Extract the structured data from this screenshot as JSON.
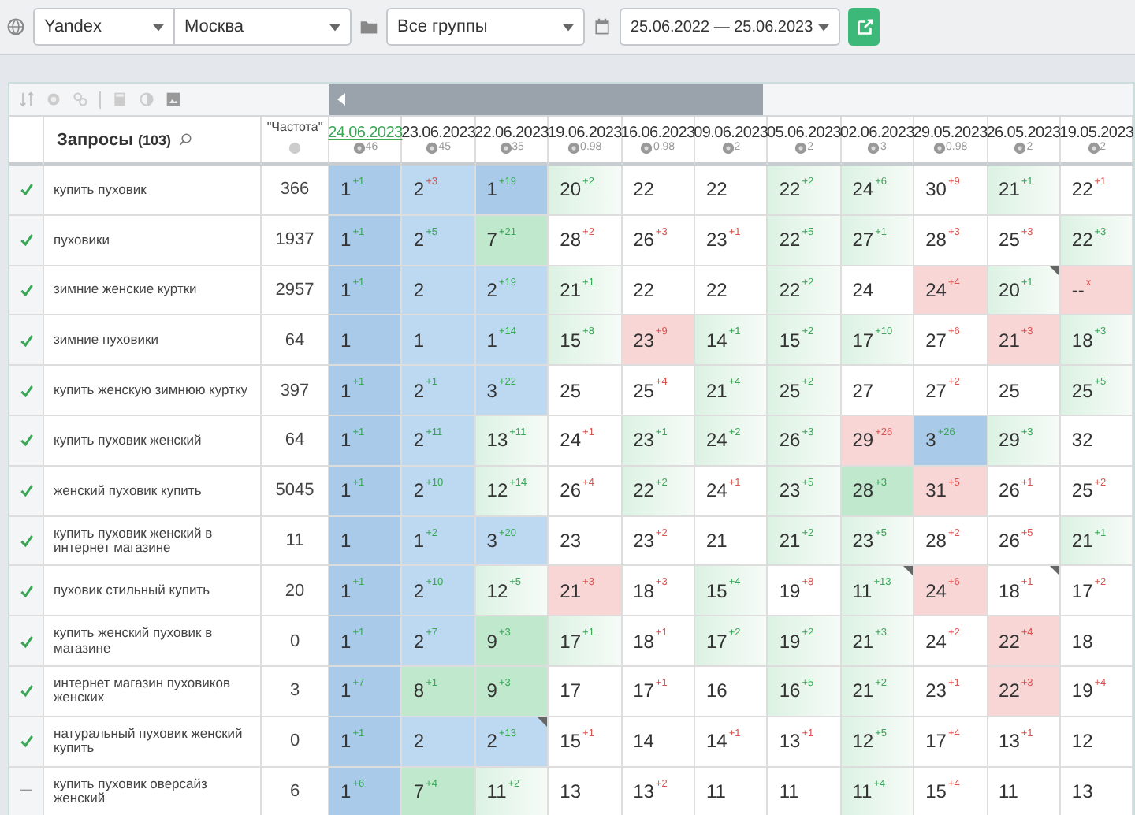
{
  "filters": {
    "engine": "Yandex",
    "region": "Москва",
    "group": "Все группы",
    "period": "25.06.2022 — 25.06.2023"
  },
  "table": {
    "query_header": "Запросы",
    "query_count": "(103)",
    "frequency_header": "\"Частота\"",
    "dates": [
      {
        "label": "24.06.2023",
        "value": "46",
        "selected": true
      },
      {
        "label": "23.06.2023",
        "value": "45",
        "selected": false
      },
      {
        "label": "22.06.2023",
        "value": "35",
        "selected": false
      },
      {
        "label": "19.06.2023",
        "value": "0.98",
        "selected": false
      },
      {
        "label": "16.06.2023",
        "value": "0.98",
        "selected": false
      },
      {
        "label": "09.06.2023",
        "value": "2",
        "selected": false
      },
      {
        "label": "05.06.2023",
        "value": "2",
        "selected": false
      },
      {
        "label": "02.06.2023",
        "value": "3",
        "selected": false
      },
      {
        "label": "29.05.2023",
        "value": "0.98",
        "selected": false
      },
      {
        "label": "26.05.2023",
        "value": "2",
        "selected": false
      },
      {
        "label": "19.05.2023",
        "value": "2",
        "selected": false
      }
    ],
    "rows": [
      {
        "query": "купить пуховик",
        "frequency": "366",
        "checked": true,
        "cells": [
          {
            "value": "1",
            "change": "+1",
            "improved": true,
            "kind": "blue"
          },
          {
            "value": "2",
            "change": "+3",
            "improved": false,
            "kind": "sky"
          },
          {
            "value": "1",
            "change": "+19",
            "improved": true,
            "kind": "blue"
          },
          {
            "value": "20",
            "change": "+2",
            "improved": true,
            "kind": "mint"
          },
          {
            "value": "22",
            "kind": "plain"
          },
          {
            "value": "22",
            "kind": "plain"
          },
          {
            "value": "22",
            "change": "+2",
            "improved": true,
            "kind": "mint"
          },
          {
            "value": "24",
            "change": "+6",
            "improved": true,
            "kind": "mint"
          },
          {
            "value": "30",
            "change": "+9",
            "improved": false,
            "kind": "plain"
          },
          {
            "value": "21",
            "change": "+1",
            "improved": true,
            "kind": "mint"
          },
          {
            "value": "22",
            "change": "+1",
            "improved": false,
            "kind": "plain"
          }
        ]
      },
      {
        "query": "пуховики",
        "frequency": "1937",
        "checked": true,
        "cells": [
          {
            "value": "1",
            "change": "+1",
            "improved": true,
            "kind": "blue"
          },
          {
            "value": "2",
            "change": "+5",
            "improved": true,
            "kind": "sky"
          },
          {
            "value": "7",
            "change": "+21",
            "improved": true,
            "kind": "green"
          },
          {
            "value": "28",
            "change": "+2",
            "improved": false,
            "kind": "plain"
          },
          {
            "value": "26",
            "change": "+3",
            "improved": false,
            "kind": "plain"
          },
          {
            "value": "23",
            "change": "+1",
            "improved": false,
            "kind": "plain"
          },
          {
            "value": "22",
            "change": "+5",
            "improved": true,
            "kind": "mint"
          },
          {
            "value": "27",
            "change": "+1",
            "improved": true,
            "kind": "mint"
          },
          {
            "value": "28",
            "change": "+3",
            "improved": false,
            "kind": "plain"
          },
          {
            "value": "25",
            "change": "+3",
            "improved": false,
            "kind": "plain"
          },
          {
            "value": "22",
            "change": "+3",
            "improved": true,
            "kind": "mint"
          }
        ]
      },
      {
        "query": "зимние женские куртки",
        "frequency": "2957",
        "checked": true,
        "cells": [
          {
            "value": "1",
            "change": "+1",
            "improved": true,
            "kind": "blue"
          },
          {
            "value": "2",
            "kind": "sky"
          },
          {
            "value": "2",
            "change": "+19",
            "improved": true,
            "kind": "sky"
          },
          {
            "value": "21",
            "change": "+1",
            "improved": true,
            "kind": "mint"
          },
          {
            "value": "22",
            "kind": "plain"
          },
          {
            "value": "22",
            "kind": "plain"
          },
          {
            "value": "22",
            "change": "+2",
            "improved": true,
            "kind": "mint"
          },
          {
            "value": "24",
            "kind": "plain"
          },
          {
            "value": "24",
            "change": "+4",
            "improved": false,
            "kind": "red"
          },
          {
            "value": "20",
            "change": "+1",
            "improved": true,
            "kind": "mint",
            "flagged": true
          },
          {
            "value": "--",
            "change": "x",
            "improved": false,
            "kind": "red"
          }
        ]
      },
      {
        "query": "зимние пуховики",
        "frequency": "64",
        "checked": true,
        "cells": [
          {
            "value": "1",
            "kind": "blue"
          },
          {
            "value": "1",
            "kind": "sky"
          },
          {
            "value": "1",
            "change": "+14",
            "improved": true,
            "kind": "sky"
          },
          {
            "value": "15",
            "change": "+8",
            "improved": true,
            "kind": "mint"
          },
          {
            "value": "23",
            "change": "+9",
            "improved": false,
            "kind": "red"
          },
          {
            "value": "14",
            "change": "+1",
            "improved": true,
            "kind": "mint"
          },
          {
            "value": "15",
            "change": "+2",
            "improved": true,
            "kind": "mint"
          },
          {
            "value": "17",
            "change": "+10",
            "improved": true,
            "kind": "mint"
          },
          {
            "value": "27",
            "change": "+6",
            "improved": false,
            "kind": "plain"
          },
          {
            "value": "21",
            "change": "+3",
            "improved": false,
            "kind": "red"
          },
          {
            "value": "18",
            "change": "+3",
            "improved": true,
            "kind": "mint"
          }
        ]
      },
      {
        "query": "купить женскую зимнюю куртку",
        "frequency": "397",
        "checked": true,
        "cells": [
          {
            "value": "1",
            "change": "+1",
            "improved": true,
            "kind": "blue"
          },
          {
            "value": "2",
            "change": "+1",
            "improved": true,
            "kind": "sky"
          },
          {
            "value": "3",
            "change": "+22",
            "improved": true,
            "kind": "sky"
          },
          {
            "value": "25",
            "kind": "plain"
          },
          {
            "value": "25",
            "change": "+4",
            "improved": false,
            "kind": "plain"
          },
          {
            "value": "21",
            "change": "+4",
            "improved": true,
            "kind": "mint"
          },
          {
            "value": "25",
            "change": "+2",
            "improved": true,
            "kind": "mint"
          },
          {
            "value": "27",
            "kind": "plain"
          },
          {
            "value": "27",
            "change": "+2",
            "improved": false,
            "kind": "plain"
          },
          {
            "value": "25",
            "kind": "plain"
          },
          {
            "value": "25",
            "change": "+5",
            "improved": true,
            "kind": "mint"
          }
        ]
      },
      {
        "query": "купить пуховик женский",
        "frequency": "64",
        "checked": true,
        "cells": [
          {
            "value": "1",
            "change": "+1",
            "improved": true,
            "kind": "blue"
          },
          {
            "value": "2",
            "change": "+11",
            "improved": true,
            "kind": "sky"
          },
          {
            "value": "13",
            "change": "+11",
            "improved": true,
            "kind": "mint"
          },
          {
            "value": "24",
            "change": "+1",
            "improved": false,
            "kind": "plain"
          },
          {
            "value": "23",
            "change": "+1",
            "improved": true,
            "kind": "mint"
          },
          {
            "value": "24",
            "change": "+2",
            "improved": true,
            "kind": "mint"
          },
          {
            "value": "26",
            "change": "+3",
            "improved": true,
            "kind": "mint"
          },
          {
            "value": "29",
            "change": "+26",
            "improved": false,
            "kind": "red"
          },
          {
            "value": "3",
            "change": "+26",
            "improved": true,
            "kind": "blue"
          },
          {
            "value": "29",
            "change": "+3",
            "improved": true,
            "kind": "mint"
          },
          {
            "value": "32",
            "kind": "plain"
          }
        ]
      },
      {
        "query": "женский пуховик купить",
        "frequency": "5045",
        "checked": true,
        "cells": [
          {
            "value": "1",
            "change": "+1",
            "improved": true,
            "kind": "blue"
          },
          {
            "value": "2",
            "change": "+10",
            "improved": true,
            "kind": "sky"
          },
          {
            "value": "12",
            "change": "+14",
            "improved": true,
            "kind": "mint"
          },
          {
            "value": "26",
            "change": "+4",
            "improved": false,
            "kind": "plain"
          },
          {
            "value": "22",
            "change": "+2",
            "improved": true,
            "kind": "mint"
          },
          {
            "value": "24",
            "change": "+1",
            "improved": false,
            "kind": "plain"
          },
          {
            "value": "23",
            "change": "+5",
            "improved": true,
            "kind": "mint"
          },
          {
            "value": "28",
            "change": "+3",
            "improved": true,
            "kind": "green"
          },
          {
            "value": "31",
            "change": "+5",
            "improved": false,
            "kind": "red"
          },
          {
            "value": "26",
            "change": "+1",
            "improved": false,
            "kind": "plain"
          },
          {
            "value": "25",
            "change": "+2",
            "improved": false,
            "kind": "plain"
          }
        ]
      },
      {
        "query": "купить пуховик женский в интернет магазине",
        "frequency": "11",
        "checked": true,
        "cells": [
          {
            "value": "1",
            "kind": "blue"
          },
          {
            "value": "1",
            "change": "+2",
            "improved": true,
            "kind": "sky"
          },
          {
            "value": "3",
            "change": "+20",
            "improved": true,
            "kind": "sky"
          },
          {
            "value": "23",
            "kind": "plain"
          },
          {
            "value": "23",
            "change": "+2",
            "improved": false,
            "kind": "plain"
          },
          {
            "value": "21",
            "kind": "plain"
          },
          {
            "value": "21",
            "change": "+2",
            "improved": true,
            "kind": "mint"
          },
          {
            "value": "23",
            "change": "+5",
            "improved": true,
            "kind": "mint"
          },
          {
            "value": "28",
            "change": "+2",
            "improved": false,
            "kind": "plain"
          },
          {
            "value": "26",
            "change": "+5",
            "improved": false,
            "kind": "plain"
          },
          {
            "value": "21",
            "change": "+1",
            "improved": true,
            "kind": "mint"
          }
        ]
      },
      {
        "query": "пуховик стильный купить",
        "frequency": "20",
        "checked": true,
        "cells": [
          {
            "value": "1",
            "change": "+1",
            "improved": true,
            "kind": "blue"
          },
          {
            "value": "2",
            "change": "+10",
            "improved": true,
            "kind": "sky"
          },
          {
            "value": "12",
            "change": "+5",
            "improved": true,
            "kind": "mint"
          },
          {
            "value": "21",
            "change": "+3",
            "improved": false,
            "kind": "red"
          },
          {
            "value": "18",
            "change": "+3",
            "improved": false,
            "kind": "plain"
          },
          {
            "value": "15",
            "change": "+4",
            "improved": true,
            "kind": "mint"
          },
          {
            "value": "19",
            "change": "+8",
            "improved": false,
            "kind": "plain"
          },
          {
            "value": "11",
            "change": "+13",
            "improved": true,
            "kind": "mint",
            "flagged": true
          },
          {
            "value": "24",
            "change": "+6",
            "improved": false,
            "kind": "red"
          },
          {
            "value": "18",
            "change": "+1",
            "improved": false,
            "kind": "plain",
            "flagged": true
          },
          {
            "value": "17",
            "change": "+2",
            "improved": false,
            "kind": "plain"
          }
        ]
      },
      {
        "query": "купить женский пуховик в магазине",
        "frequency": "0",
        "checked": true,
        "cells": [
          {
            "value": "1",
            "change": "+1",
            "improved": true,
            "kind": "blue"
          },
          {
            "value": "2",
            "change": "+7",
            "improved": true,
            "kind": "sky"
          },
          {
            "value": "9",
            "change": "+3",
            "improved": true,
            "kind": "green"
          },
          {
            "value": "17",
            "change": "+1",
            "improved": true,
            "kind": "mint"
          },
          {
            "value": "18",
            "change": "+1",
            "improved": false,
            "kind": "plain"
          },
          {
            "value": "17",
            "change": "+2",
            "improved": true,
            "kind": "mint"
          },
          {
            "value": "19",
            "change": "+2",
            "improved": true,
            "kind": "mint"
          },
          {
            "value": "21",
            "change": "+3",
            "improved": true,
            "kind": "mint"
          },
          {
            "value": "24",
            "change": "+2",
            "improved": false,
            "kind": "plain"
          },
          {
            "value": "22",
            "change": "+4",
            "improved": false,
            "kind": "red"
          },
          {
            "value": "18",
            "kind": "plain"
          }
        ]
      },
      {
        "query": "интернет магазин пуховиков женских",
        "frequency": "3",
        "checked": true,
        "cells": [
          {
            "value": "1",
            "change": "+7",
            "improved": true,
            "kind": "blue"
          },
          {
            "value": "8",
            "change": "+1",
            "improved": true,
            "kind": "green"
          },
          {
            "value": "9",
            "change": "+3",
            "improved": true,
            "kind": "green"
          },
          {
            "value": "17",
            "kind": "plain"
          },
          {
            "value": "17",
            "change": "+1",
            "improved": false,
            "kind": "plain"
          },
          {
            "value": "16",
            "kind": "plain"
          },
          {
            "value": "16",
            "change": "+5",
            "improved": true,
            "kind": "mint"
          },
          {
            "value": "21",
            "change": "+2",
            "improved": true,
            "kind": "mint"
          },
          {
            "value": "23",
            "change": "+1",
            "improved": false,
            "kind": "plain"
          },
          {
            "value": "22",
            "change": "+3",
            "improved": false,
            "kind": "red"
          },
          {
            "value": "19",
            "change": "+4",
            "improved": false,
            "kind": "plain"
          }
        ]
      },
      {
        "query": "натуральный пуховик женский купить",
        "frequency": "0",
        "checked": true,
        "cells": [
          {
            "value": "1",
            "change": "+1",
            "improved": true,
            "kind": "blue"
          },
          {
            "value": "2",
            "kind": "sky"
          },
          {
            "value": "2",
            "change": "+13",
            "improved": true,
            "kind": "sky",
            "flagged": true
          },
          {
            "value": "15",
            "change": "+1",
            "improved": false,
            "kind": "plain"
          },
          {
            "value": "14",
            "kind": "plain"
          },
          {
            "value": "14",
            "change": "+1",
            "improved": false,
            "kind": "plain"
          },
          {
            "value": "13",
            "change": "+1",
            "improved": false,
            "kind": "plain"
          },
          {
            "value": "12",
            "change": "+5",
            "improved": true,
            "kind": "mint"
          },
          {
            "value": "17",
            "change": "+4",
            "improved": false,
            "kind": "plain"
          },
          {
            "value": "13",
            "change": "+1",
            "improved": false,
            "kind": "plain"
          },
          {
            "value": "12",
            "kind": "plain"
          }
        ]
      },
      {
        "query": "купить пуховик оверсайз женский",
        "frequency": "6",
        "checked": false,
        "cells": [
          {
            "value": "1",
            "change": "+6",
            "improved": true,
            "kind": "blue"
          },
          {
            "value": "7",
            "change": "+4",
            "improved": true,
            "kind": "green"
          },
          {
            "value": "11",
            "change": "+2",
            "improved": true,
            "kind": "mint"
          },
          {
            "value": "13",
            "kind": "plain"
          },
          {
            "value": "13",
            "change": "+2",
            "improved": false,
            "kind": "plain"
          },
          {
            "value": "11",
            "kind": "plain"
          },
          {
            "value": "11",
            "kind": "plain"
          },
          {
            "value": "11",
            "change": "+4",
            "improved": true,
            "kind": "mint"
          },
          {
            "value": "15",
            "change": "+4",
            "improved": false,
            "kind": "plain"
          },
          {
            "value": "11",
            "kind": "plain"
          },
          {
            "value": "13",
            "kind": "plain"
          }
        ]
      }
    ]
  }
}
